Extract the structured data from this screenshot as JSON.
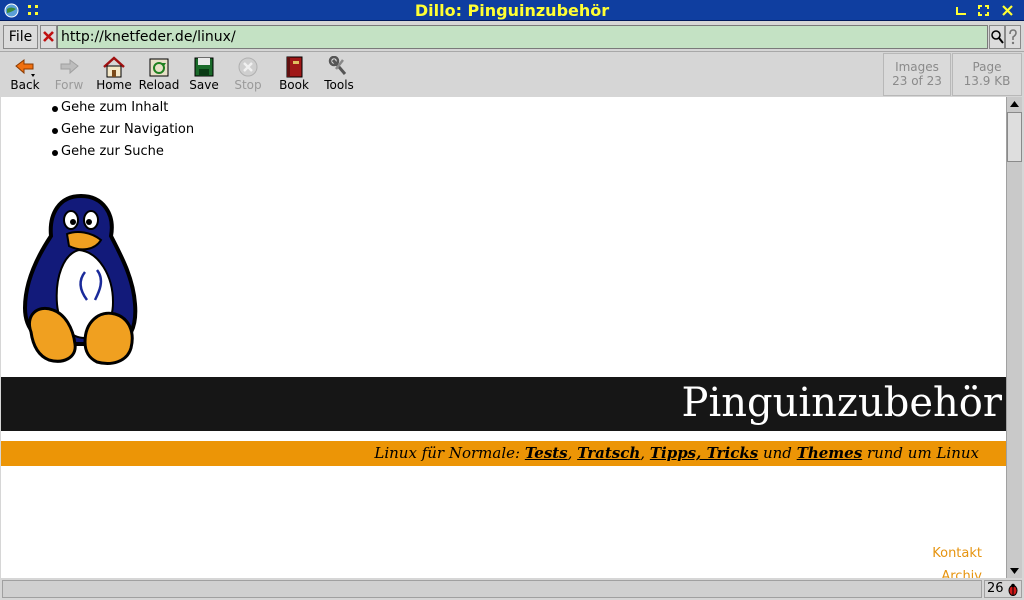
{
  "window": {
    "title": "Dillo: Pinguinzubehör"
  },
  "location": {
    "file_label": "File",
    "url": "http://knetfeder.de/linux/"
  },
  "toolbar": {
    "back": "Back",
    "forward": "Forw",
    "home": "Home",
    "reload": "Reload",
    "save": "Save",
    "stop": "Stop",
    "bookmarks": "Book",
    "tools": "Tools",
    "images_label": "Images",
    "images_value": "23 of 23",
    "page_label": "Page",
    "page_value": "13.9 KB"
  },
  "page": {
    "skip_links": [
      "Gehe zum Inhalt",
      "Gehe zur Navigation",
      "Gehe zur Suche"
    ],
    "site_title": "Pinguinzubehör",
    "tagline": {
      "prefix": "Linux für Normale: ",
      "tests": "Tests",
      "sep1": ", ",
      "tratsch": "Tratsch",
      "sep2": ", ",
      "tipps": "Tipps, Tricks",
      "und": " und ",
      "themes": "Themes",
      "suffix": " rund um Linux"
    },
    "side_links": [
      "Kontakt",
      "Archiv"
    ]
  },
  "status": {
    "bug_count": "26"
  },
  "colors": {
    "titlebar": "#0f3ea0",
    "title_text": "#ffff33",
    "url_bg": "#c4e2c4",
    "header_band": "#161616",
    "accent_band": "#ec9506",
    "link_orange": "#e69410"
  }
}
